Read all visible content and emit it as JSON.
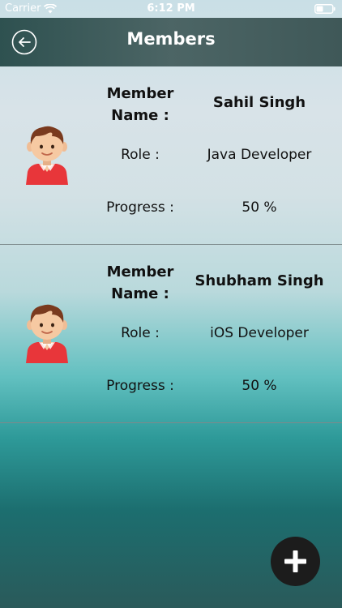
{
  "status_bar": {
    "carrier": "Carrier",
    "time": "6:12 PM"
  },
  "nav": {
    "title": "Members",
    "back_icon": "back-arrow-icon"
  },
  "field_labels": {
    "name": "Member Name :",
    "role": "Role :",
    "progress": "Progress :"
  },
  "members": [
    {
      "name": "Sahil Singh",
      "role": "Java Developer",
      "progress": "50 %",
      "progress_value": 50,
      "avatar_icon": "boy-avatar-icon"
    },
    {
      "name": "Shubham Singh",
      "role": "iOS Developer",
      "progress": "50 %",
      "progress_value": 50,
      "avatar_icon": "boy-avatar-icon"
    }
  ],
  "fab": {
    "icon": "plus-icon"
  },
  "colors": {
    "nav_bar": "#3f5858",
    "fab": "#1c1c1c",
    "avatar_shirt": "#e8363a",
    "avatar_hair": "#7a3a1e",
    "avatar_skin": "#f6c9a2"
  }
}
